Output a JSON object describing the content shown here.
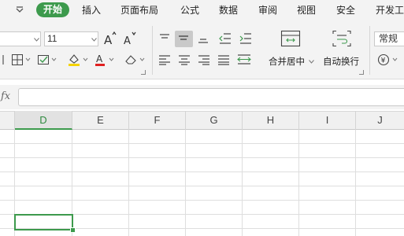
{
  "menu": {
    "items": [
      "开始",
      "插入",
      "页面布局",
      "公式",
      "数据",
      "审阅",
      "视图",
      "安全",
      "开发工"
    ]
  },
  "ribbon": {
    "font_size": "11",
    "merge_label": "合并居中",
    "wrap_label": "自动换行",
    "number_format": "常规"
  },
  "formula_bar": {
    "fx": "fx",
    "value": ""
  },
  "sheet": {
    "columns": [
      "D",
      "E",
      "F",
      "G",
      "H",
      "I",
      "J"
    ],
    "active_column": "D"
  },
  "colors": {
    "accent": "#3d9a4d",
    "font_color_bar": "#e02020",
    "fill_color_bar": "#f5d300"
  },
  "icons": [
    "menu-dropdown-icon",
    "increase-font-icon",
    "decrease-font-icon",
    "border-icon",
    "format-icon",
    "fill-color-icon",
    "font-color-icon",
    "clear-icon",
    "align-icons",
    "merge-cells-icon",
    "wrap-text-icon",
    "currency-icon"
  ]
}
